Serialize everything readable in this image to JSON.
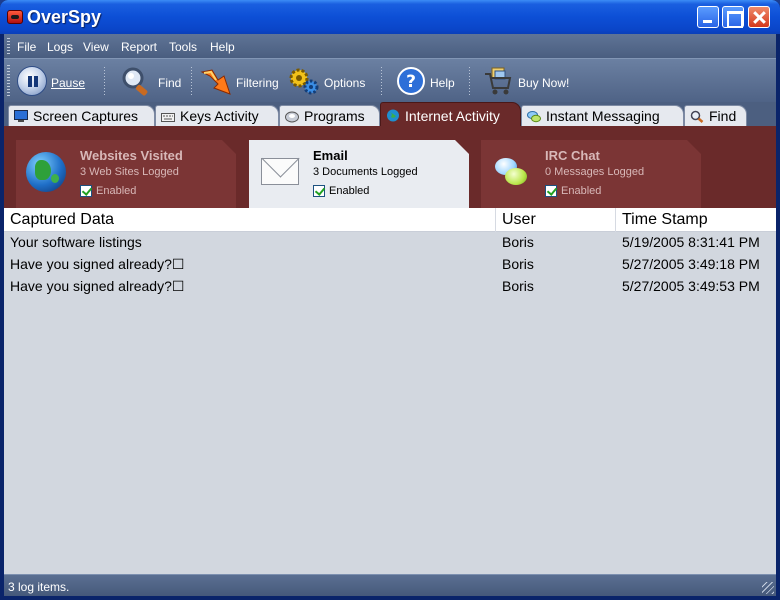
{
  "window": {
    "title": "OverSpy"
  },
  "menu": [
    "File",
    "Logs",
    "View",
    "Report",
    "Tools",
    "Help"
  ],
  "toolbar": {
    "pause": "Pause",
    "find": "Find",
    "filtering": "Filtering",
    "options": "Options",
    "help": "Help",
    "buy": "Buy Now!"
  },
  "tabs": [
    {
      "label": "Screen Captures",
      "active": false
    },
    {
      "label": "Keys Activity",
      "active": false
    },
    {
      "label": "Programs",
      "active": false
    },
    {
      "label": "Internet Activity",
      "active": true
    },
    {
      "label": "Instant Messaging",
      "active": false
    },
    {
      "label": "Find",
      "active": false
    }
  ],
  "categories": [
    {
      "title": "Websites Visited",
      "sub": "3 Web Sites Logged",
      "enabled_label": "Enabled",
      "enabled": true,
      "selected": false
    },
    {
      "title": "Email",
      "sub": "3 Documents Logged",
      "enabled_label": "Enabled",
      "enabled": true,
      "selected": true
    },
    {
      "title": "IRC Chat",
      "sub": "0 Messages Logged",
      "enabled_label": "Enabled",
      "enabled": true,
      "selected": false
    }
  ],
  "list": {
    "columns": [
      "Captured Data",
      "User",
      "Time Stamp"
    ],
    "rows": [
      {
        "data": "Your software listings",
        "user": "Boris",
        "time": "5/19/2005 8:31:41 PM"
      },
      {
        "data": "Have you signed already?☐",
        "user": "Boris",
        "time": "5/27/2005 3:49:18 PM"
      },
      {
        "data": "Have you signed already?☐",
        "user": "Boris",
        "time": "5/27/2005 3:49:53 PM"
      }
    ]
  },
  "status": {
    "text": "3 log items."
  },
  "colors": {
    "accent_panel": "#6a2a2a",
    "titlebar": "#0d4fd6",
    "list_bg": "#d2d7df"
  }
}
